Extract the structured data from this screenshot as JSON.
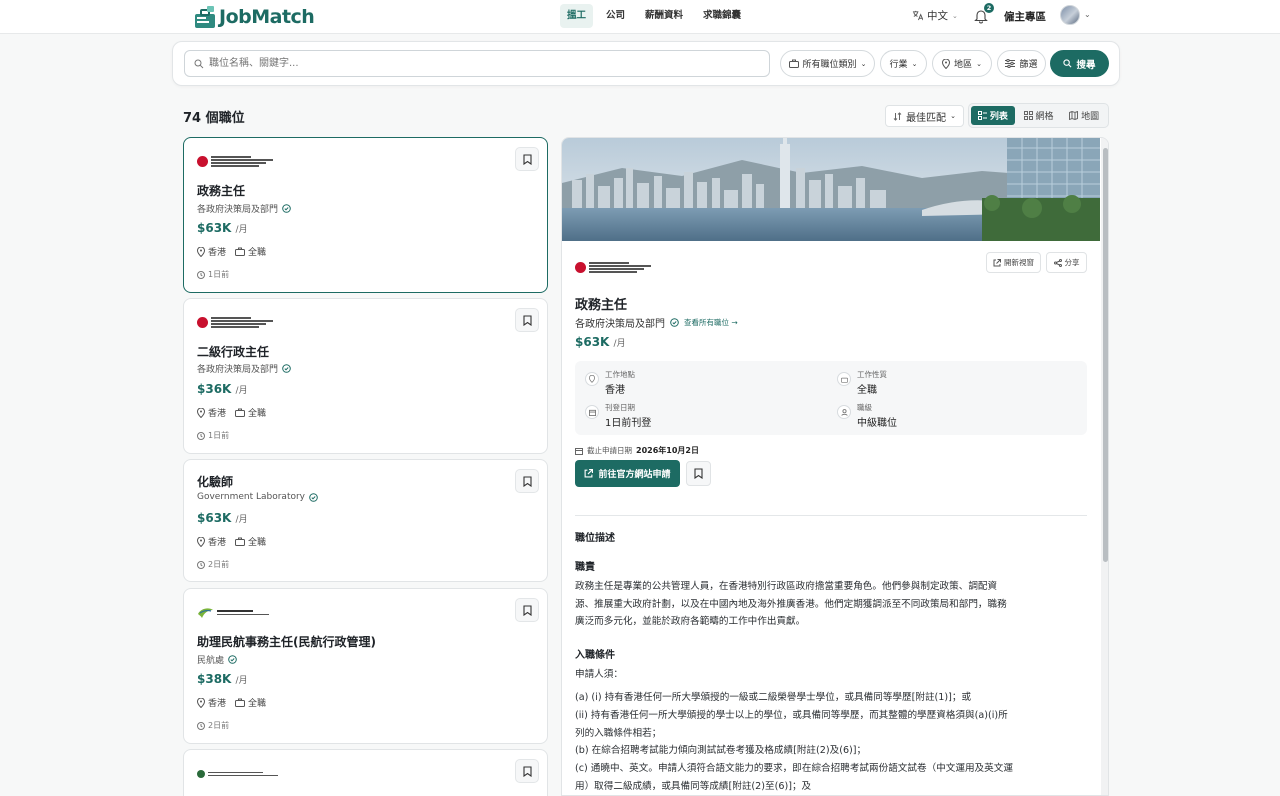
{
  "header": {
    "logo_text": "JobMatch",
    "nav": [
      "搵工",
      "公司",
      "薪酬資料",
      "求職錦囊"
    ],
    "language": "中文",
    "notification_count": "2",
    "employer_link": "僱主專區"
  },
  "search": {
    "placeholder": "職位名稱、關鍵字...",
    "category_filter": "所有職位類別",
    "industry_filter": "行業",
    "region_filter": "地區",
    "more_filters": "篩選",
    "search_button": "搜尋"
  },
  "results": {
    "count": "74 個職位",
    "sort": "最佳匹配",
    "views": [
      "列表",
      "網格",
      "地圖"
    ]
  },
  "jobs": [
    {
      "title": "政務主任",
      "company": "各政府決策局及部門",
      "salary": "$63K",
      "per": "/月",
      "location": "香港",
      "type": "全職",
      "posted": "1日前"
    },
    {
      "title": "二級行政主任",
      "company": "各政府決策局及部門",
      "salary": "$36K",
      "per": "/月",
      "location": "香港",
      "type": "全職",
      "posted": "1日前"
    },
    {
      "title": "化驗師",
      "company": "Government Laboratory",
      "salary": "$63K",
      "per": "/月",
      "location": "香港",
      "type": "全職",
      "posted": "2日前"
    },
    {
      "title": "助理民航事務主任(民航行政管理)",
      "company": "民航處",
      "salary": "$38K",
      "per": "/月",
      "location": "香港",
      "type": "全職",
      "posted": "2日前"
    }
  ],
  "detail": {
    "open_new_window": "開新視窗",
    "share": "分享",
    "title": "政務主任",
    "company": "各政府決策局及部門",
    "view_all": "查看所有職位 →",
    "salary": "$63K",
    "per": "/月",
    "location_label": "工作地點",
    "location": "香港",
    "type_label": "工作性質",
    "type": "全職",
    "posted_label": "刊登日期",
    "posted": "1日前刊登",
    "level_label": "職級",
    "level": "中級職位",
    "deadline_label": "截止申請日期",
    "deadline": "2026年10月2日",
    "apply_button": "前往官方網站申請",
    "desc_heading": "職位描述",
    "duties_heading": "職責",
    "duties_text": "政務主任是專業的公共管理人員，在香港特別行政區政府擔當重要角色。他們參與制定政策、調配資源、推展重大政府計劃，以及在中國內地及海外推廣香港。他們定期獲調派至不同政策局和部門，職務廣泛而多元化，並能於政府各範疇的工作中作出貢獻。",
    "req_heading": "入職條件",
    "req_intro": "申請人須：",
    "req_a": "(a) (i) 持有香港任何一所大學頒授的一級或二級榮譽學士學位，或具備同等學歷[附註(1)]；或",
    "req_a2": "(ii) 持有香港任何一所大學頒授的學士以上的學位，或具備同等學歷，而其整體的學歷資格須與(a)(i)所列的入職條件相若；",
    "req_b": "(b) 在綜合招聘考試能力傾向測試試卷考獲及格成績[附註(2)及(6)]；",
    "req_c": "(c) 通曉中、英文。申請人須符合語文能力的要求，即在綜合招聘考試兩份語文試卷（中文運用及英文運用）取得二級成績，或具備同等成績[附註(2)至(6)]；及"
  },
  "colors": {
    "brand": "#1d6b63",
    "accent_light": "#e9f2f0"
  }
}
